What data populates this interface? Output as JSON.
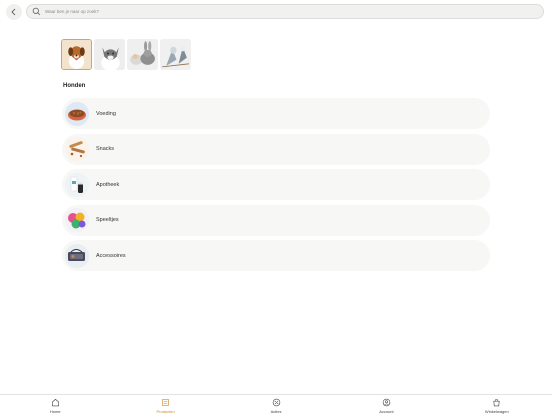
{
  "search": {
    "placeholder": "Waar ben je naar op zoek?"
  },
  "pets": [
    {
      "name": "Honden",
      "icon": "dog-photo",
      "active": true
    },
    {
      "name": "Katten",
      "icon": "cat-photo",
      "active": false
    },
    {
      "name": "Knaagdieren",
      "icon": "rabbit-photo",
      "active": false
    },
    {
      "name": "Vogels",
      "icon": "bird-photo",
      "active": false
    }
  ],
  "section": {
    "title": "Honden"
  },
  "categories": [
    {
      "label": "Voeding",
      "icon": "food-bowl-icon"
    },
    {
      "label": "Snacks",
      "icon": "snacks-icon"
    },
    {
      "label": "Apotheek",
      "icon": "pharmacy-icon"
    },
    {
      "label": "Speeltjes",
      "icon": "toys-icon"
    },
    {
      "label": "Accessoires",
      "icon": "accessories-icon"
    }
  ],
  "nav": {
    "items": [
      {
        "label": "Home",
        "icon": "home-icon"
      },
      {
        "label": "Producten",
        "icon": "products-icon",
        "active": true
      },
      {
        "label": "Acties",
        "icon": "percent-icon"
      },
      {
        "label": "Account",
        "icon": "account-icon"
      },
      {
        "label": "Winkelwagen",
        "icon": "cart-icon"
      }
    ]
  },
  "colors": {
    "accent": "#c7892e",
    "background": "#ffffff",
    "row": "#f7f7f6"
  }
}
